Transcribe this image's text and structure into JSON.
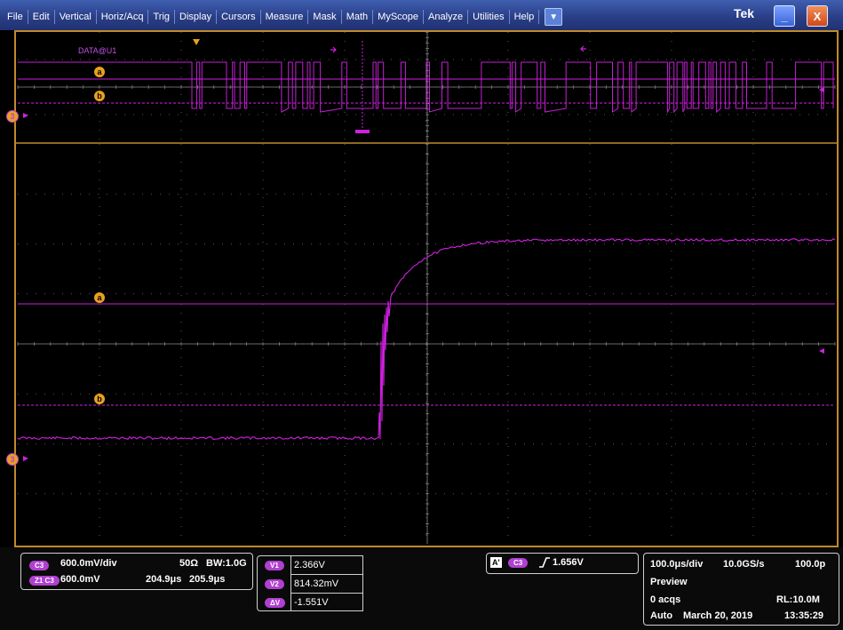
{
  "menubar": {
    "items": [
      "File",
      "Edit",
      "Vertical",
      "Horiz/Acq",
      "Trig",
      "Display",
      "Cursors",
      "Measure",
      "Mask",
      "Math",
      "MyScope",
      "Analyze",
      "Utilities",
      "Help"
    ],
    "brand": "Tek",
    "min_label": "_",
    "close_label": "X"
  },
  "display": {
    "bus_label": "DATA@U1",
    "cursor_a": "a",
    "cursor_b": "b",
    "channel_marker": "3",
    "colors": {
      "trace": "#d020e0",
      "grid": "#8a8a8a",
      "border": "#c08a2a",
      "cursor": "#e8a020"
    }
  },
  "channel_box": {
    "ch_label": "C3",
    "volts_div": "600.0mV/div",
    "impedance": "50Ω",
    "bw": "W:1.0G",
    "bw_prefix": "B",
    "ref_label": "Z1 C3",
    "offset": "600.0mV",
    "zoom_t1": "204.9μs",
    "zoom_t2": "205.9μs"
  },
  "cursor_box": {
    "v1_label": "V1",
    "v1": "2.366V",
    "v2_label": "V2",
    "v2": "814.32mV",
    "dv_label": "ΔV",
    "dv": "-1.551V"
  },
  "trigger_box": {
    "a_label": "A'",
    "source": "C3",
    "level": "1.656V"
  },
  "acq_box": {
    "time_div": "100.0μs/div",
    "sample_rate": "10.0GS/s",
    "res": "100.0p",
    "mode": "Preview",
    "acqs": "0 acqs",
    "record_length": "RL:10.0M",
    "run_mode": "Auto",
    "date": "March 20, 2019",
    "time": "13:35:29"
  }
}
